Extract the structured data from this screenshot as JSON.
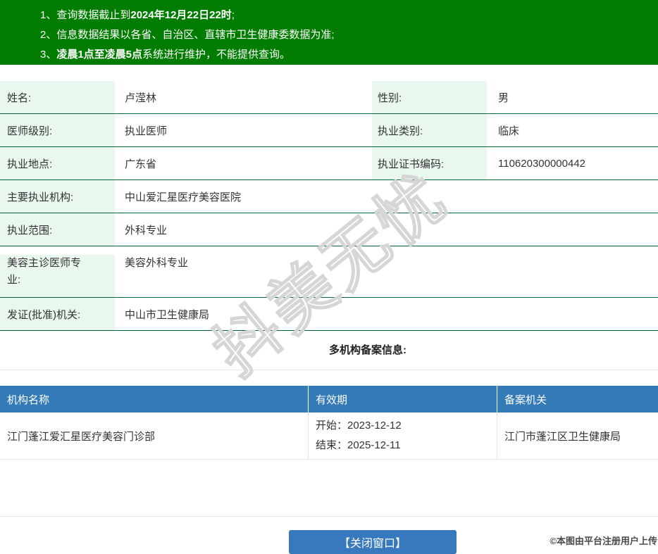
{
  "colors": {
    "banner_bg": "#007D00",
    "label_bg": "#E9F7EE",
    "row_separator": "#006633",
    "table_header_bg": "#337AB7",
    "button_bg": "#3879BD",
    "light_line": "#E8E8E8"
  },
  "banner": {
    "notices": [
      {
        "num": "1、",
        "pre": "查询数据截止到",
        "bold": "2024年12月22日22时",
        "post": ";"
      },
      {
        "num": "2、",
        "pre": "信息数据结果以各省、自治区、直辖市卫生健康委数据为准;",
        "bold": "",
        "post": ""
      },
      {
        "num": "3、",
        "pre": "",
        "bold": "凌晨1点至凌晨5点",
        "post": "系统进行维护，不能提供查询。"
      }
    ]
  },
  "info_table": {
    "rows": [
      {
        "label1": "姓名:",
        "value1": "卢滢林",
        "label2": "性别:",
        "value2": "男"
      },
      {
        "label1": "医师级别:",
        "value1": "执业医师",
        "label2": "执业类别:",
        "value2": "临床"
      },
      {
        "label1": "执业地点:",
        "value1": "广东省",
        "label2": "执业证书编码:",
        "value2": "110620300000442"
      },
      {
        "label1": "主要执业机构:",
        "value1": "中山爱汇星医疗美容医院"
      },
      {
        "label1": "执业范围:",
        "value1": "外科专业"
      },
      {
        "label1": "美容主诊医师专业:",
        "value1": "美容外科专业"
      },
      {
        "label1": "发证(批准)机关:",
        "value1": "中山市卫生健康局"
      }
    ]
  },
  "section_title": "多机构备案信息:",
  "backup_table": {
    "headers": [
      "机构名称",
      "有效期",
      "备案机关"
    ],
    "rows": [
      {
        "org": "江门蓬江爱汇星医疗美容门诊部",
        "valid_start": "开始：2023-12-12",
        "valid_end": "结束：2025-12-11",
        "authority": "江门市蓬江区卫生健康局"
      }
    ]
  },
  "close_button_label": "【关闭窗口】",
  "watermark_diagonal": "抖美无忧",
  "watermark_copyright": "©本图由平台注册用户上传"
}
